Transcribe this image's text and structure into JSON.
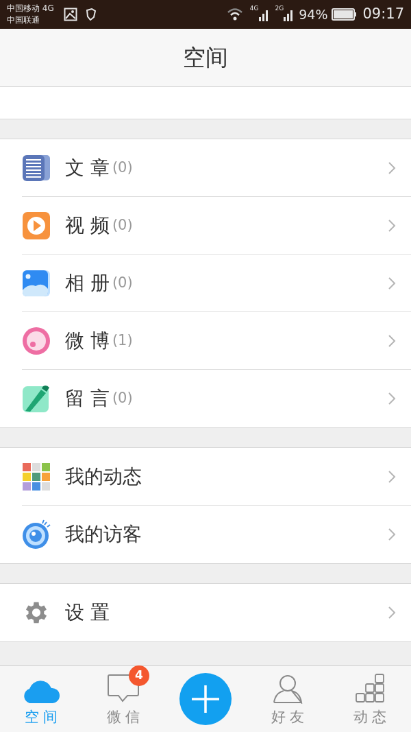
{
  "status_bar": {
    "carrier_1": "中国移动 4G",
    "carrier_2": "中国联通",
    "network_1": "4G",
    "network_2": "2G",
    "battery": "94%",
    "time": "09:17"
  },
  "header": {
    "title": "空间"
  },
  "groups": [
    {
      "items": [
        {
          "kind": "article",
          "label": "文 章",
          "count": "(0)"
        },
        {
          "kind": "video",
          "label": "视 频",
          "count": "(0)"
        },
        {
          "kind": "album",
          "label": "相 册",
          "count": "(0)"
        },
        {
          "kind": "weibo",
          "label": "微 博",
          "count": "(1)"
        },
        {
          "kind": "message",
          "label": "留 言",
          "count": "(0)"
        }
      ]
    },
    {
      "items": [
        {
          "kind": "feed",
          "label": "我的动态"
        },
        {
          "kind": "visitors",
          "label": "我的访客"
        }
      ]
    },
    {
      "items": [
        {
          "kind": "settings",
          "label": "设 置"
        }
      ]
    }
  ],
  "tab_bar": [
    {
      "kind": "space",
      "label": "空 间",
      "selected": true
    },
    {
      "kind": "chat",
      "label": "微 信",
      "selected": false,
      "badge": "4"
    },
    {
      "kind": "add",
      "selected": false
    },
    {
      "kind": "friends",
      "label": "好 友",
      "selected": false
    },
    {
      "kind": "activity",
      "label": "动 态",
      "selected": false
    }
  ]
}
